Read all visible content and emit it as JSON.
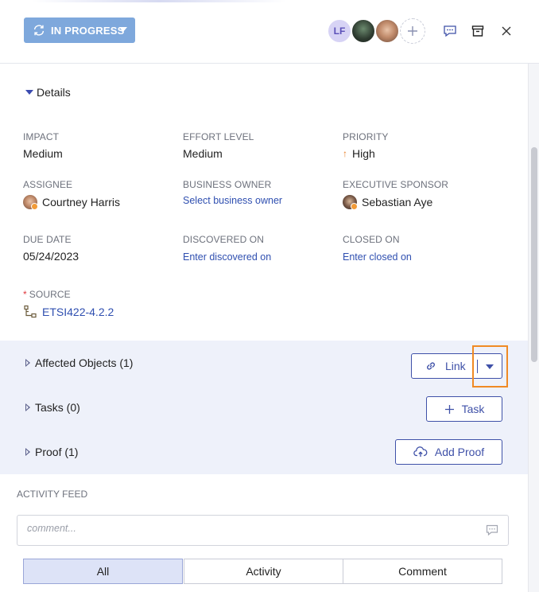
{
  "header": {
    "status_label": "IN PROGRESS",
    "avatars": [
      {
        "initials": "LF",
        "kind": "initials"
      },
      {
        "initials": "",
        "kind": "photo"
      },
      {
        "initials": "",
        "kind": "photo"
      }
    ]
  },
  "details": {
    "toggle_label": "Details",
    "impact": {
      "label": "IMPACT",
      "value": "Medium"
    },
    "effort": {
      "label": "EFFORT LEVEL",
      "value": "Medium"
    },
    "priority": {
      "label": "PRIORITY",
      "value": "High"
    },
    "assignee": {
      "label": "ASSIGNEE",
      "value": "Courtney Harris"
    },
    "business_owner": {
      "label": "BUSINESS OWNER",
      "value": "Select business owner"
    },
    "executive_sponsor": {
      "label": "EXECUTIVE SPONSOR",
      "value": "Sebastian Aye"
    },
    "due_date": {
      "label": "DUE DATE",
      "value": "05/24/2023"
    },
    "discovered_on": {
      "label": "DISCOVERED ON",
      "value": "Enter discovered on"
    },
    "closed_on": {
      "label": "CLOSED ON",
      "value": "Enter closed on"
    },
    "source": {
      "required_mark": "*",
      "label": "SOURCE",
      "value": "ETSI422-4.2.2"
    }
  },
  "sections": {
    "affected_objects": "Affected Objects (1)",
    "tasks": "Tasks (0)",
    "proof": "Proof (1)",
    "link_button": "Link",
    "task_button": "Task",
    "add_proof_button": "Add Proof"
  },
  "activity": {
    "label": "ACTIVITY FEED",
    "comment_placeholder": "comment...",
    "tabs": [
      "All",
      "Activity",
      "Comment"
    ],
    "active_tab": "All"
  },
  "colors": {
    "status_button": "#7ea8dc",
    "link": "#2f4fb0",
    "primary_outline": "#3f51a8",
    "section_bg": "#eef1fa",
    "highlight": "#f08a24",
    "priority_high": "#e8802a"
  }
}
